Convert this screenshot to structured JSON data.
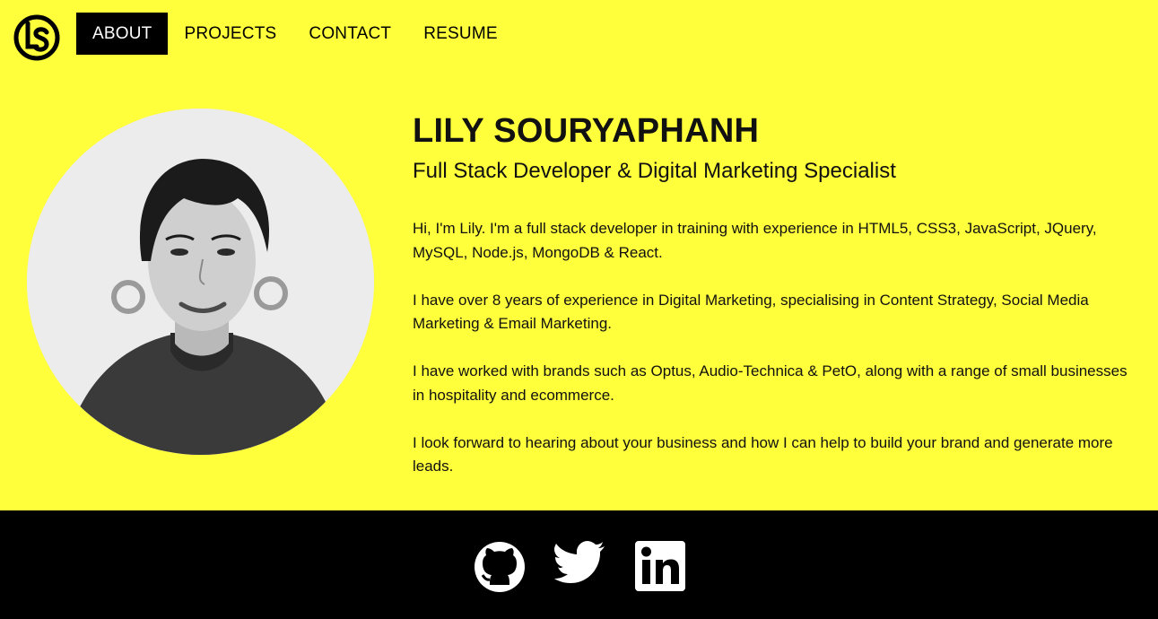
{
  "nav": {
    "logo_icon": "ls-monogram-icon",
    "items": [
      {
        "label": "ABOUT",
        "active": true
      },
      {
        "label": "PROJECTS",
        "active": false
      },
      {
        "label": "CONTACT",
        "active": false
      },
      {
        "label": "RESUME",
        "active": false
      }
    ]
  },
  "profile": {
    "photo_icon": "profile-photo",
    "name": "LILY SOURYAPHANH",
    "title": "Full Stack Developer & Digital Marketing Specialist",
    "bio": [
      "Hi, I'm Lily. I'm a full stack developer in training with experience in HTML5, CSS3, JavaScript, JQuery, MySQL, Node.js, MongoDB & React.",
      "I have over 8 years of experience in Digital Marketing, specialising in Content Strategy, Social Media Marketing & Email Marketing.",
      "I have worked with brands such as Optus, Audio-Technica & PetO, along with a range of small businesses in hospitality and ecommerce.",
      "I look forward to hearing about your business and how I can help to build your brand and generate more leads."
    ]
  },
  "footer": {
    "social": [
      {
        "icon": "github-icon"
      },
      {
        "icon": "twitter-icon"
      },
      {
        "icon": "linkedin-icon"
      }
    ]
  },
  "colors": {
    "background": "#ffff3c",
    "footer": "#000000",
    "active_nav_bg": "#000000",
    "active_nav_text": "#ffffff"
  }
}
